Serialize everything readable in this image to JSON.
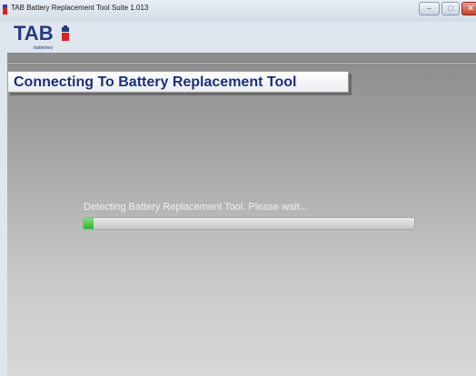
{
  "window": {
    "title": "TAB Battery Replacement Tool Suite 1.013",
    "controls": {
      "minimize_glyph": "–",
      "maximize_glyph": "□",
      "close_glyph": "✕"
    }
  },
  "logo": {
    "brand": "TAB",
    "subtitle": "batteries"
  },
  "main": {
    "header_title": "Connecting To Battery Replacement Tool",
    "status_text": "Detecting Battery Replacement Tool. Please wait...",
    "progress_fraction": 0.03
  },
  "colors": {
    "brand_blue": "#243a80",
    "brand_red": "#d8232a",
    "header_text": "#1c2f7a",
    "progress_green": "#28b428"
  },
  "icons": {
    "app_icon": "battery-icon"
  }
}
